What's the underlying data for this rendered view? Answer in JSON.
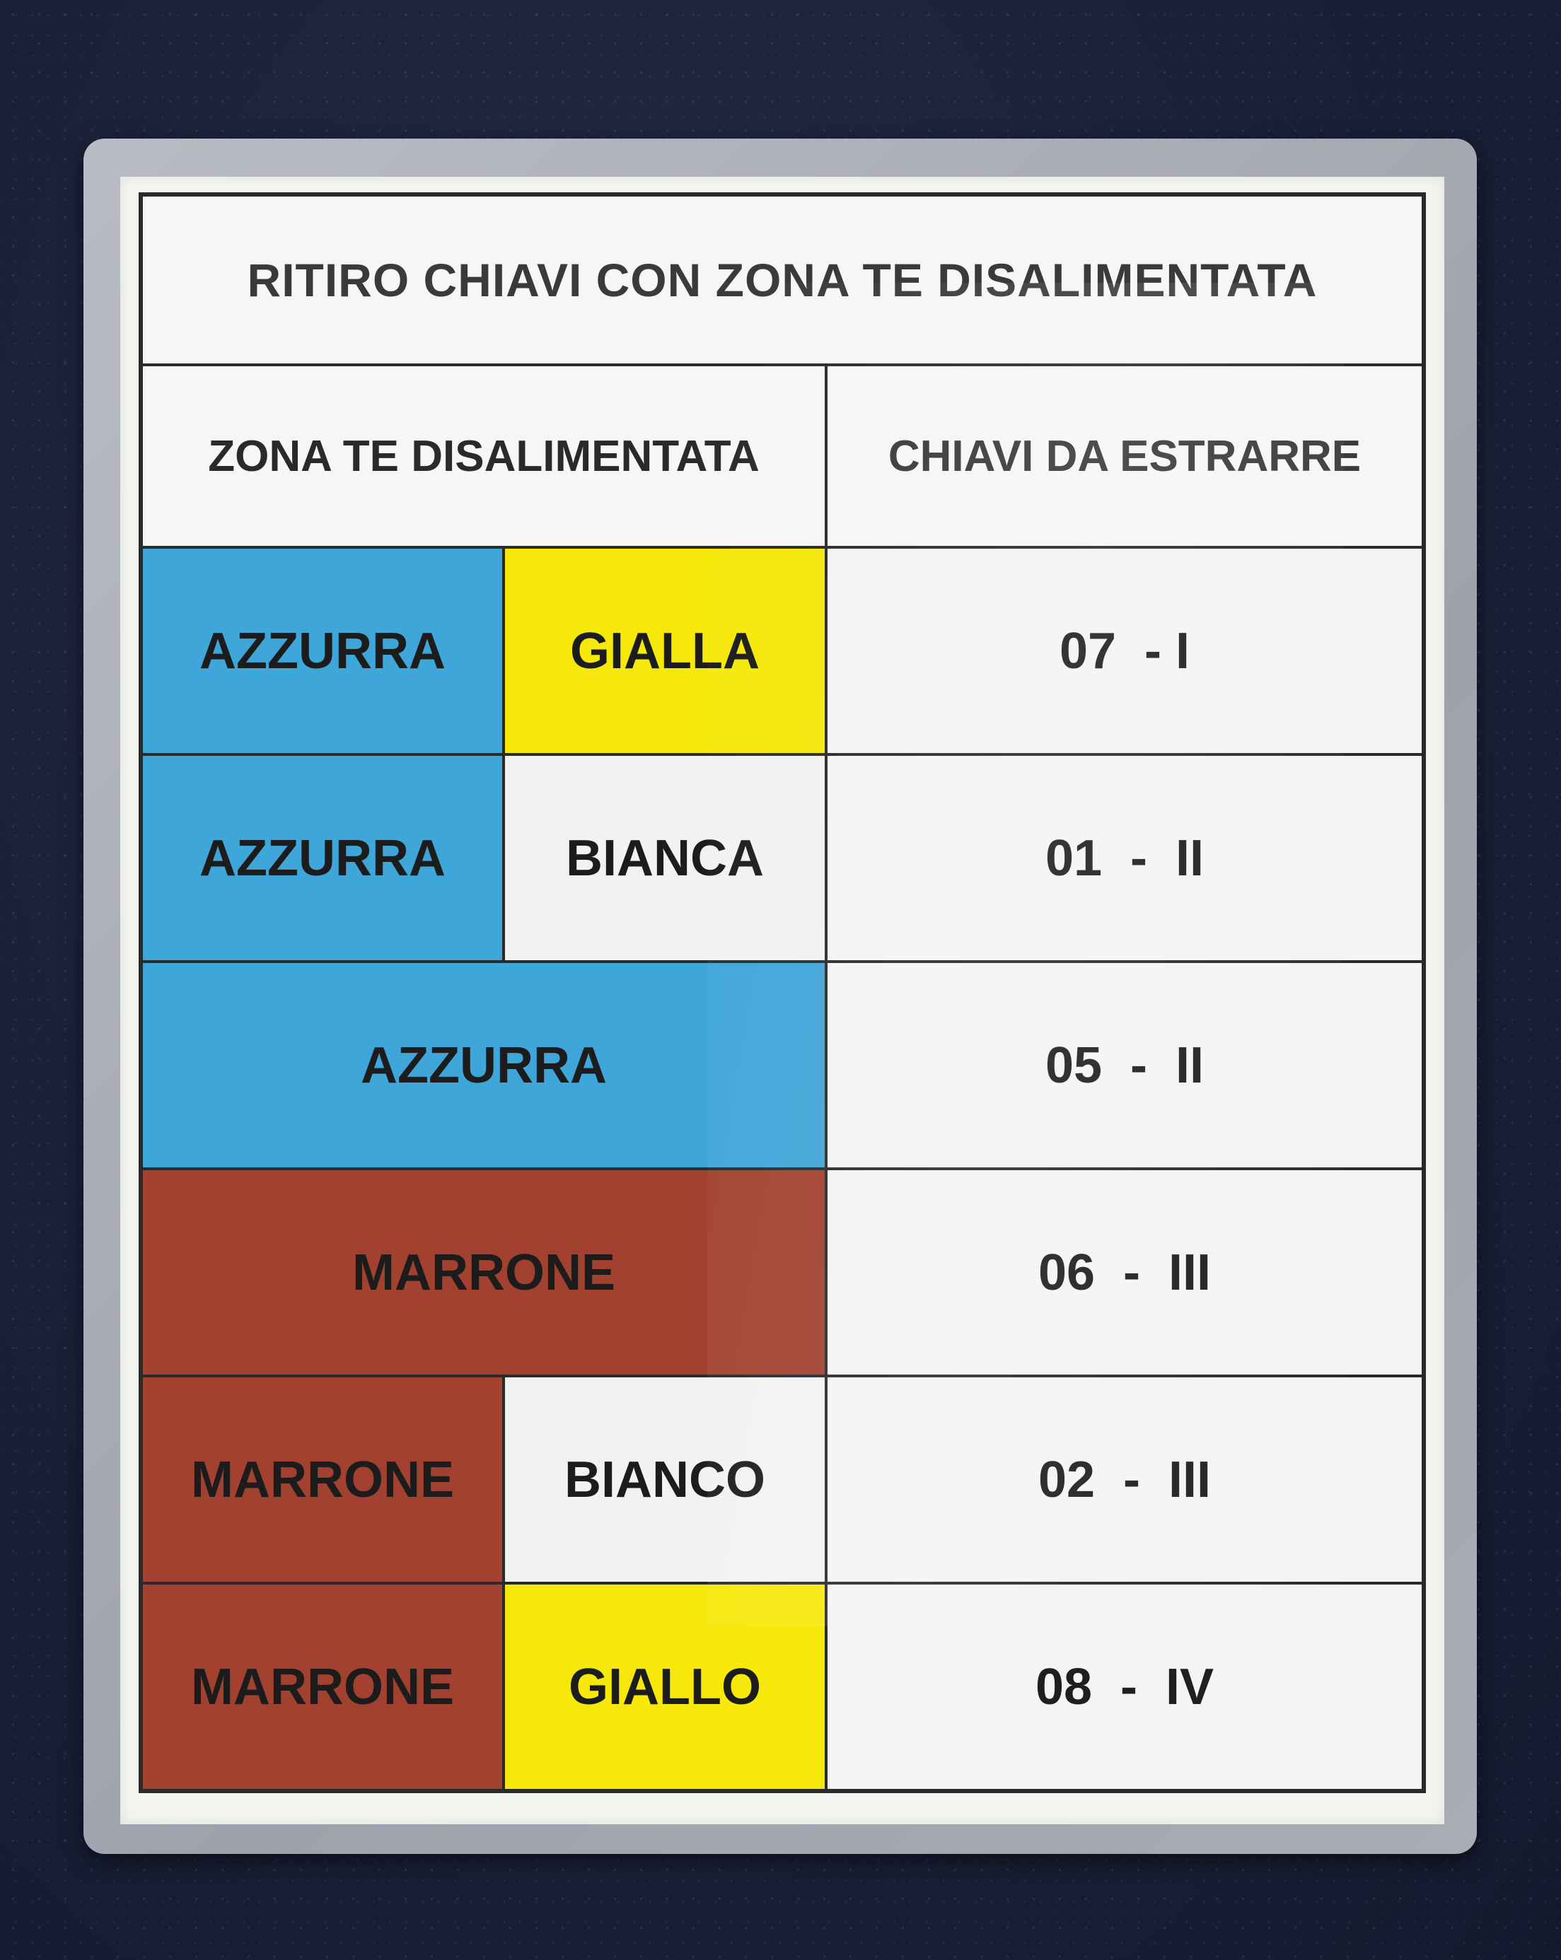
{
  "title": "RITIRO CHIAVI CON ZONA TE DISALIMENTATA",
  "headers": {
    "zone": "ZONA TE DISALIMENTATA",
    "keys": "CHIAVI DA ESTRARRE"
  },
  "colors": {
    "azzurra": "#3fa6d9",
    "gialla": "#f5e80a",
    "bianca": "#f2f2f0",
    "marrone": "#a24130",
    "background": "#1a2038"
  },
  "rows": [
    {
      "zone_a": "AZZURRA",
      "zone_b": "GIALLA",
      "keys": "07  - I"
    },
    {
      "zone_a": "AZZURRA",
      "zone_b": "BIANCA",
      "keys": "01  -  II"
    },
    {
      "zone_a": "AZZURRA",
      "keys": "05  -  II"
    },
    {
      "zone_a": "MARRONE",
      "keys": "06  -  III"
    },
    {
      "zone_a": "MARRONE",
      "zone_b": "BIANCO",
      "keys": "02  -  III"
    },
    {
      "zone_a": "MARRONE",
      "zone_b": "GIALLO",
      "keys": "08  -  IV"
    }
  ]
}
